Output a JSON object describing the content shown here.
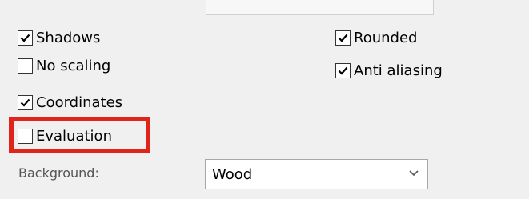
{
  "options": [
    {
      "label": "Shadows",
      "checked": true
    },
    {
      "label": "No scaling",
      "checked": false
    },
    {
      "label": "Coordinates",
      "checked": true
    },
    {
      "label": "Evaluation",
      "checked": false
    },
    {
      "label": "Rounded",
      "checked": true
    },
    {
      "label": "Anti aliasing",
      "checked": true
    }
  ],
  "background": {
    "label": "Background:",
    "value": "Wood"
  },
  "highlight_color": "#e2231a"
}
